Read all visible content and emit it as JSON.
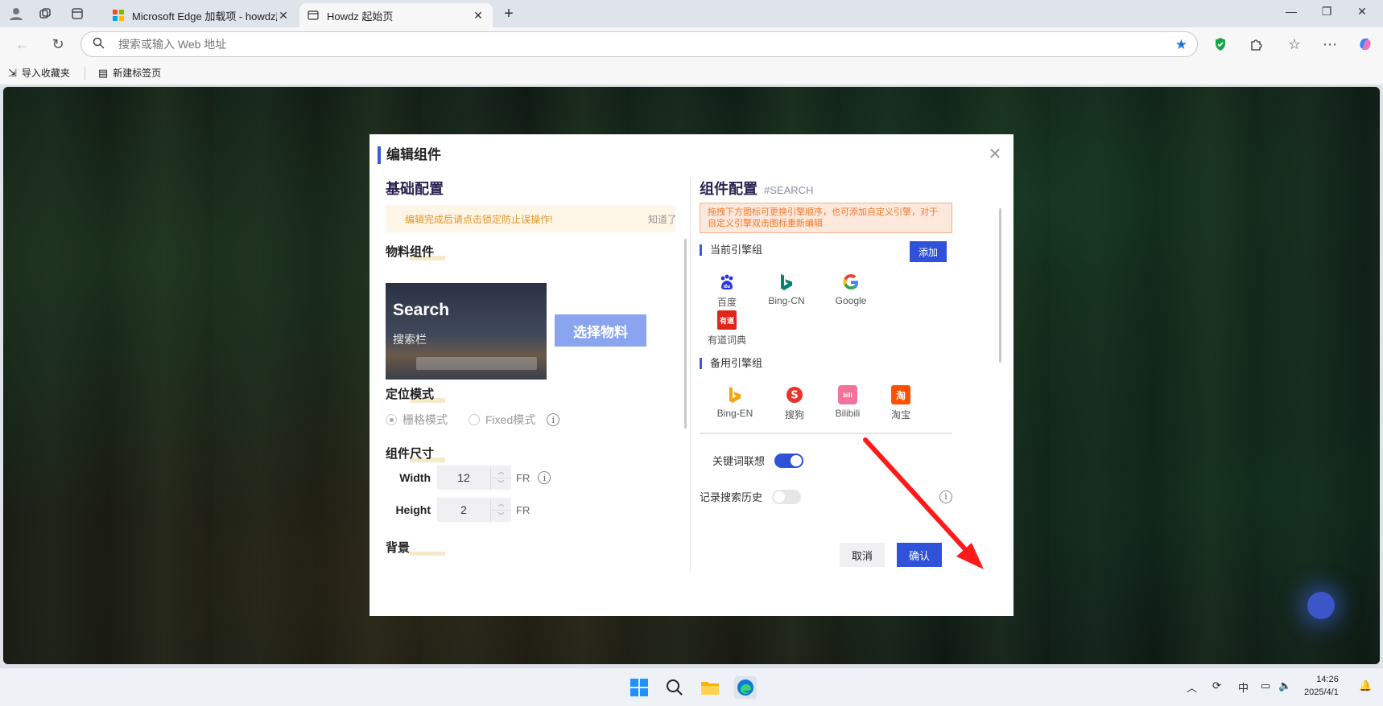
{
  "browser": {
    "tabs": [
      {
        "title": "Microsoft Edge 加载项 - howdz起"
      },
      {
        "title": "Howdz 起始页"
      }
    ],
    "address_placeholder": "搜索或输入 Web 地址",
    "favorites": [
      {
        "label": "导入收藏夹"
      },
      {
        "label": "新建标签页"
      }
    ]
  },
  "modal": {
    "title": "编辑组件",
    "left": {
      "heading": "基础配置",
      "notice": "编辑完成后请点击锁定防止误操作!",
      "notice_action": "知道了",
      "material_heading": "物料组件",
      "thumb_title": "Search",
      "thumb_subtitle": "搜索栏",
      "pick_button": "选择物料",
      "position_heading": "定位模式",
      "position_options": [
        "栅格模式",
        "Fixed模式"
      ],
      "size_heading": "组件尺寸",
      "width_label": "Width",
      "width_value": "12",
      "height_label": "Height",
      "height_value": "2",
      "unit": "FR",
      "background_heading": "背景"
    },
    "right": {
      "heading": "组件配置",
      "tag": "#SEARCH",
      "hint": "拖拽下方图标可更换引擎顺序，也可添加自定义引擎，对于自定义引擎双击图标重新编辑",
      "current_group": "当前引擎组",
      "add_button": "添加",
      "current_engines": [
        {
          "name": "百度",
          "icon": "baidu-icon",
          "color": "#2932e1"
        },
        {
          "name": "Bing-CN",
          "icon": "bing-icon",
          "color": "#008373"
        },
        {
          "name": "Google",
          "icon": "google-icon",
          "color": "#4285f4"
        },
        {
          "name": "有道词典",
          "icon": "youdao-icon",
          "color": "#e1251b"
        }
      ],
      "backup_group": "备用引擎组",
      "backup_engines": [
        {
          "name": "Bing-EN",
          "icon": "bing-icon",
          "color": "#f4a316"
        },
        {
          "name": "搜狗",
          "icon": "sogou-icon",
          "color": "#e8332a"
        },
        {
          "name": "Bilibili",
          "icon": "bilibili-icon",
          "color": "#f2739a"
        },
        {
          "name": "淘宝",
          "icon": "taobao-icon",
          "color": "#ff5000"
        }
      ],
      "toggles": [
        {
          "label": "关键词联想",
          "on": true
        },
        {
          "label": "记录搜索历史",
          "on": false
        }
      ]
    },
    "cancel": "取消",
    "confirm": "确认"
  },
  "taskbar": {
    "ime": "中",
    "time": "14:26",
    "date": "2025/4/1"
  },
  "colors": {
    "accent": "#2f52d8",
    "annotation_arrow": "#ff1a1a"
  }
}
